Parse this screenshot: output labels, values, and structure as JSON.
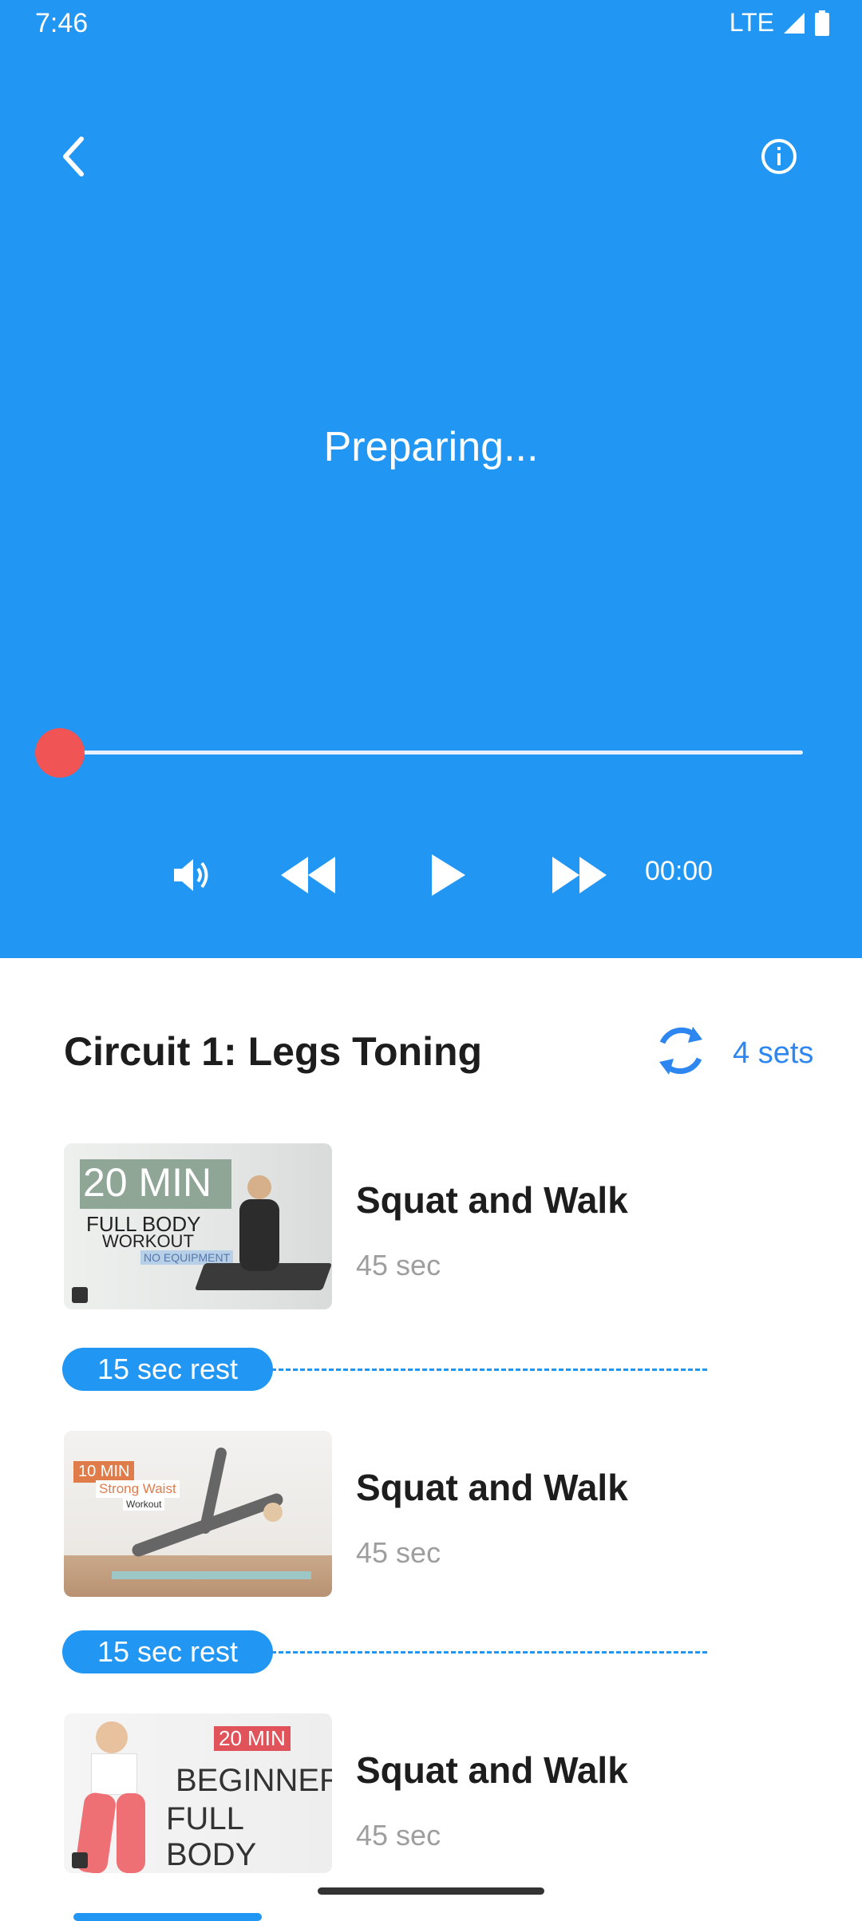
{
  "status": {
    "time": "7:46",
    "network": "LTE"
  },
  "player": {
    "status_text": "Preparing...",
    "elapsed": "00:00",
    "progress": 0
  },
  "circuit": {
    "title": "Circuit 1: Legs Toning",
    "sets": "4 sets"
  },
  "exercises": [
    {
      "name": "Squat and Walk",
      "duration": "45 sec",
      "thumb_text": [
        "20 MIN",
        "FULL BODY",
        "WORKOUT",
        "NO EQUIPMENT"
      ]
    },
    {
      "name": "Squat and Walk",
      "duration": "45 sec",
      "thumb_text": [
        "10 MIN",
        "Strong Waist",
        "Workout"
      ]
    },
    {
      "name": "Squat and Walk",
      "duration": "45 sec",
      "thumb_text": [
        "20 MIN",
        "BEGINNER",
        "FULL BODY"
      ]
    }
  ],
  "rests": [
    {
      "label": "15 sec rest"
    },
    {
      "label": "15 sec rest"
    }
  ],
  "colors": {
    "primary": "#2196F3",
    "thumb": "#F05454",
    "sets_text": "#2E86F0"
  }
}
